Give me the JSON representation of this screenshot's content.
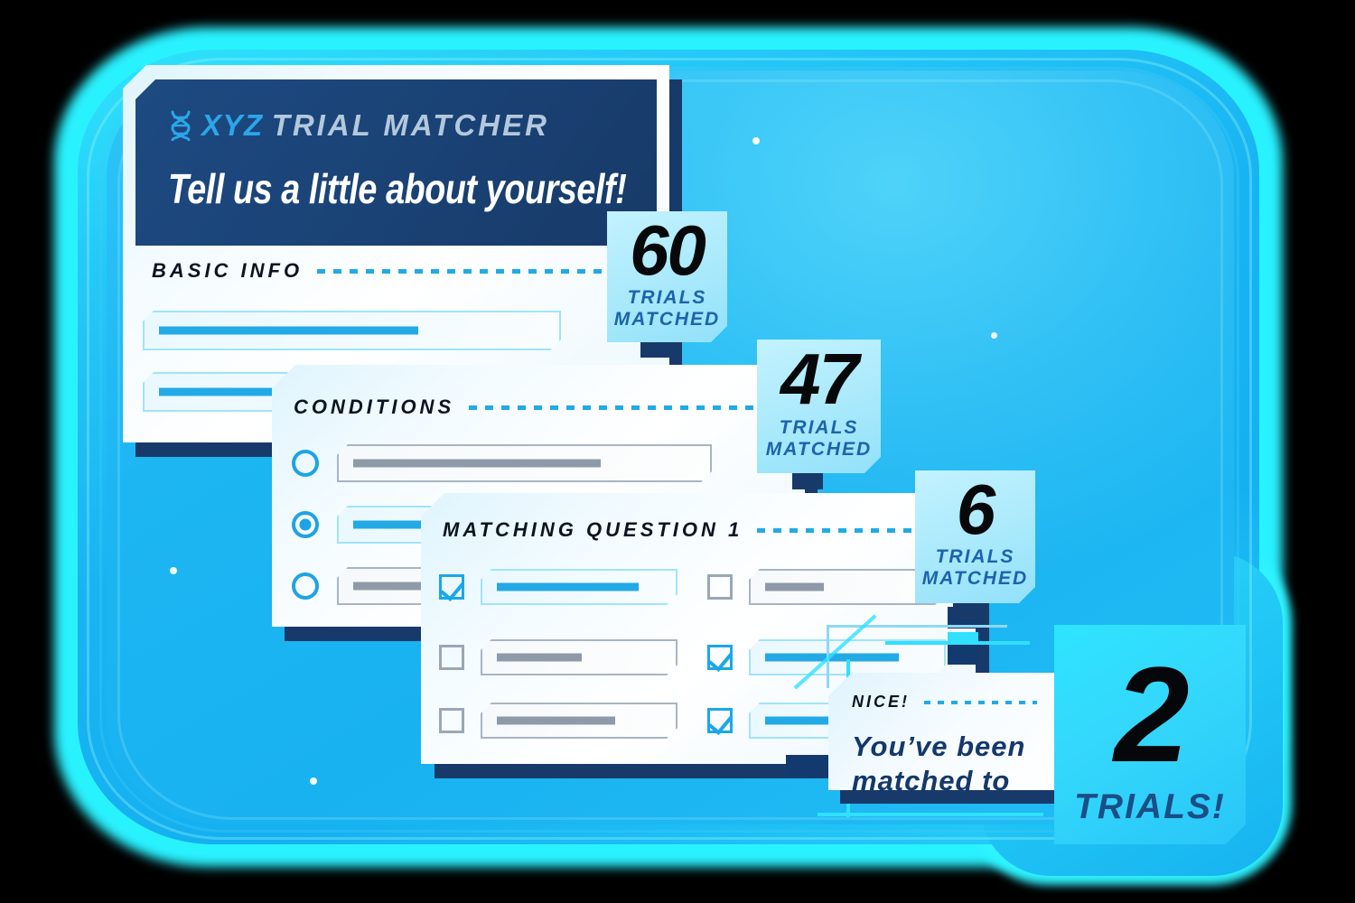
{
  "brand": {
    "logo_icon": "dna-helix-icon",
    "name": "XYZ",
    "product": "TRIAL MATCHER"
  },
  "header": {
    "tagline": "Tell us a little about yourself!"
  },
  "sections": {
    "basic_info": {
      "label": "BASIC INFO"
    },
    "conditions": {
      "label": "CONDITIONS"
    },
    "matching_question": {
      "label": "MATCHING QUESTION 1"
    },
    "nice": {
      "label": "NICE!"
    }
  },
  "basic_info_fields": [
    {
      "filled": true,
      "fill_ratio": 0.62
    },
    {
      "filled": true,
      "fill_ratio": 0.58
    }
  ],
  "conditions_options": [
    {
      "selected": false,
      "style": "gray",
      "fill_ratio": 0.66
    },
    {
      "selected": true,
      "style": "blue",
      "fill_ratio": 0.55
    },
    {
      "selected": false,
      "style": "gray",
      "fill_ratio": 0.46
    }
  ],
  "matching_checkboxes_left": [
    {
      "checked": true,
      "style": "blue",
      "fill_ratio": 0.72
    },
    {
      "checked": false,
      "style": "gray",
      "fill_ratio": 0.43
    },
    {
      "checked": false,
      "style": "gray",
      "fill_ratio": 0.6
    }
  ],
  "matching_checkboxes_right": [
    {
      "checked": false,
      "style": "gray",
      "fill_ratio": 0.3
    },
    {
      "checked": true,
      "style": "blue",
      "fill_ratio": 0.68
    },
    {
      "checked": true,
      "style": "blue",
      "fill_ratio": 0.62
    }
  ],
  "badges": [
    {
      "count": "60",
      "line1": "TRIALS",
      "line2": "MATCHED"
    },
    {
      "count": "47",
      "line1": "TRIALS",
      "line2": "MATCHED"
    },
    {
      "count": "6",
      "line1": "TRIALS",
      "line2": "MATCHED"
    }
  ],
  "result": {
    "message_line1": "You’ve been",
    "message_line2": "matched to",
    "count": "2",
    "label": "TRIALS!"
  },
  "colors": {
    "accent_cyan": "#2fe0ff",
    "brand_blue": "#2ba6e8",
    "navy": "#173a6b",
    "header_navy": "#1c4a82",
    "badge_fill": "#a9e9fc",
    "label_blue": "#1d63ac"
  }
}
